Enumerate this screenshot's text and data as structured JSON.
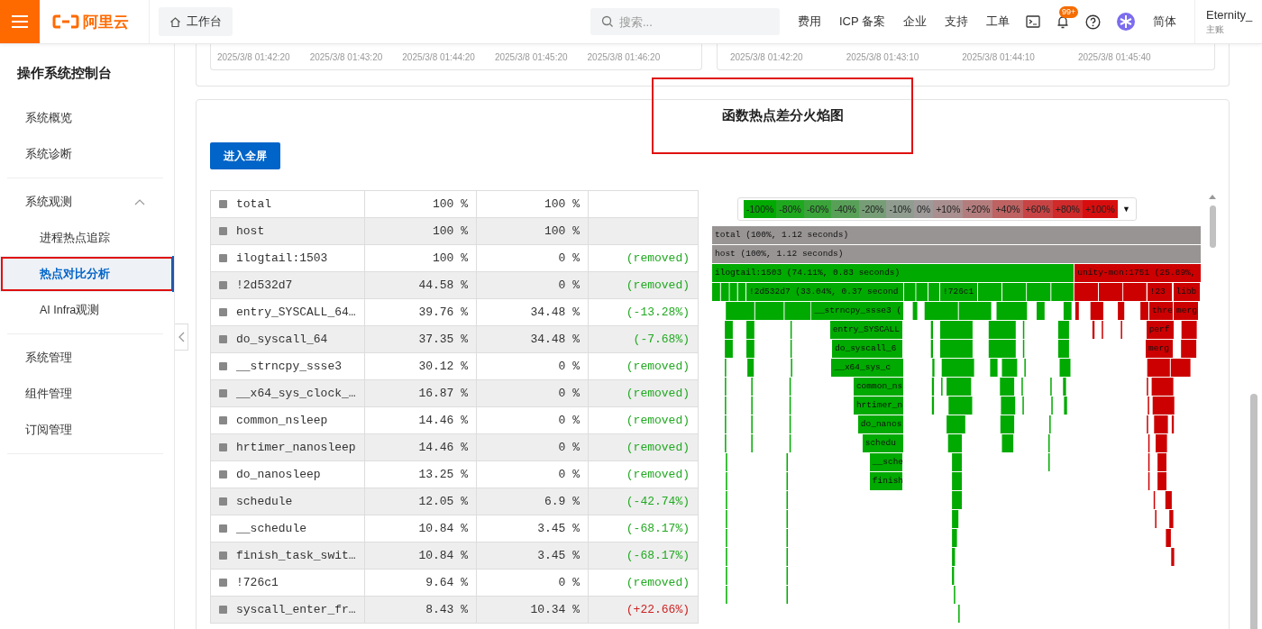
{
  "topbar": {
    "logo": "阿里云",
    "workspace": "工作台",
    "search": {
      "placeholder": "搜索..."
    },
    "links": [
      "费用",
      "ICP 备案",
      "企业",
      "支持",
      "工单"
    ],
    "notification_badge": "99+",
    "language": "简体",
    "account": {
      "name": "Eternity_",
      "role": "主账"
    }
  },
  "sidebar": {
    "title": "操作系统控制台",
    "groups": [
      {
        "items": [
          {
            "label": "系统概览",
            "selected": false
          },
          {
            "label": "系统诊断",
            "selected": false
          }
        ]
      },
      {
        "items": [
          {
            "label": "系统观测",
            "selected": false,
            "expanded": true,
            "children": [
              {
                "label": "进程热点追踪",
                "selected": false,
                "annotated": false
              },
              {
                "label": "热点对比分析",
                "selected": true,
                "annotated": true
              },
              {
                "label": "AI Infra观测",
                "selected": false,
                "annotated": false
              }
            ]
          }
        ]
      },
      {
        "items": [
          {
            "label": "系统管理",
            "selected": false
          },
          {
            "label": "组件管理",
            "selected": false
          },
          {
            "label": "订阅管理",
            "selected": false
          }
        ]
      }
    ]
  },
  "time_cards": [
    {
      "axis_labels": [
        "2025/3/8 01:42:20",
        "2025/3/8 01:43:20",
        "2025/3/8 01:44:20",
        "2025/3/8 01:45:20",
        "2025/3/8 01:46:20"
      ]
    },
    {
      "axis_labels": [
        "2025/3/8 01:42:20",
        "2025/3/8 01:43:10",
        "2025/3/8 01:44:10",
        "2025/3/8 01:45:40"
      ]
    }
  ],
  "panel": {
    "title": "函数热点差分火焰图",
    "title_annotated": true,
    "fullscreen_button": "进入全屏",
    "table": {
      "rows": [
        {
          "name": "total",
          "base": "100 %",
          "compare": "100 %"
        },
        {
          "name": "host",
          "base": "100 %",
          "compare": "100 %"
        },
        {
          "name": "ilogtail:1503",
          "base": "100 %",
          "compare": "0 %",
          "diff": "(removed)",
          "color": "#22aa22"
        },
        {
          "name": "!2d532d7",
          "base": "44.58 %",
          "compare": "0 %",
          "diff": "(removed)",
          "color": "#22aa22"
        },
        {
          "name": "entry_SYSCALL_64…",
          "base": "39.76 %",
          "compare": "34.48 %",
          "diff": "(-13.28%)",
          "color": "#22aa22"
        },
        {
          "name": "do_syscall_64",
          "base": "37.35 %",
          "compare": "34.48 %",
          "diff": "(-7.68%)",
          "color": "#22aa22"
        },
        {
          "name": "__strncpy_ssse3",
          "base": "30.12 %",
          "compare": "0 %",
          "diff": "(removed)",
          "color": "#22aa22"
        },
        {
          "name": "__x64_sys_clock_…",
          "base": "16.87 %",
          "compare": "0 %",
          "diff": "(removed)",
          "color": "#22aa22"
        },
        {
          "name": "common_nsleep",
          "base": "14.46 %",
          "compare": "0 %",
          "diff": "(removed)",
          "color": "#22aa22"
        },
        {
          "name": "hrtimer_nanosleep",
          "base": "14.46 %",
          "compare": "0 %",
          "diff": "(removed)",
          "color": "#22aa22"
        },
        {
          "name": "do_nanosleep",
          "base": "13.25 %",
          "compare": "0 %",
          "diff": "(removed)",
          "color": "#22aa22"
        },
        {
          "name": "schedule",
          "base": "12.05 %",
          "compare": "6.9 %",
          "diff": "(-42.74%)",
          "color": "#22aa22"
        },
        {
          "name": "__schedule",
          "base": "10.84 %",
          "compare": "3.45 %",
          "diff": "(-68.17%)",
          "color": "#22aa22"
        },
        {
          "name": "finish_task_swit…",
          "base": "10.84 %",
          "compare": "3.45 %",
          "diff": "(-68.17%)",
          "color": "#22aa22"
        },
        {
          "name": "!726c1",
          "base": "9.64 %",
          "compare": "0 %",
          "diff": "(removed)",
          "color": "#22aa22"
        },
        {
          "name": "syscall_enter_fr…",
          "base": "8.43 %",
          "compare": "10.34 %",
          "diff": "(+22.66%)",
          "color": "#cc2222"
        }
      ]
    },
    "legend": [
      {
        "label": "-100%",
        "color": "#00aa00"
      },
      {
        "label": "-80%",
        "color": "#1ea81e"
      },
      {
        "label": "-60%",
        "color": "#3aa43a"
      },
      {
        "label": "-40%",
        "color": "#58a058"
      },
      {
        "label": "-20%",
        "color": "#779d77"
      },
      {
        "label": "-10%",
        "color": "#8f9c8f"
      },
      {
        "label": "0%",
        "color": "#9e9a9a"
      },
      {
        "label": "+10%",
        "color": "#a98f8f"
      },
      {
        "label": "+20%",
        "color": "#b47d7d"
      },
      {
        "label": "+40%",
        "color": "#be6262"
      },
      {
        "label": "+60%",
        "color": "#c84444"
      },
      {
        "label": "+80%",
        "color": "#d02a2a"
      },
      {
        "label": "+100%",
        "color": "#d80e0e"
      }
    ],
    "legend_caret": "▼",
    "flame": {
      "frames": [
        {
          "label": "total (100%, 1.12 seconds)",
          "color": "#999494"
        },
        {
          "label": "host (100%, 1.12 seconds)",
          "color": "#999494"
        },
        {
          "label": "ilogtail:1503 (74.11%, 0.83 seconds)",
          "color": "#00aa00"
        },
        {
          "label": "unity-mon:1751 (25.89%,",
          "color": "#cc0000"
        },
        {
          "label": "!2d532d7 (33.04%, 0.37 second",
          "color": "#00aa00"
        },
        {
          "label": "!726c1",
          "color": "#00aa00"
        },
        {
          "label": "!23",
          "color": "#cc0000"
        },
        {
          "label": "libb",
          "color": "#cc0000"
        },
        {
          "label": "__strncpy_ssse3 (",
          "color": "#00aa00"
        },
        {
          "label": "thre",
          "color": "#cc0000"
        },
        {
          "label": "merg",
          "color": "#cc0000"
        },
        {
          "label": "entry_SYSCALL",
          "color": "#00aa00"
        },
        {
          "label": "perf",
          "color": "#cc0000"
        },
        {
          "label": "do_syscall_6",
          "color": "#00aa00"
        },
        {
          "label": "merg",
          "color": "#cc0000"
        },
        {
          "label": "__x64_sys_c",
          "color": "#00aa00"
        },
        {
          "label": "common_ns",
          "color": "#00aa00"
        },
        {
          "label": "hrtimer_n",
          "color": "#00aa00"
        },
        {
          "label": "do_nanos",
          "color": "#00aa00"
        },
        {
          "label": "schedu",
          "color": "#00aa00"
        },
        {
          "label": "__sche",
          "color": "#00aa00"
        },
        {
          "label": "finish",
          "color": "#00aa00"
        }
      ]
    }
  }
}
